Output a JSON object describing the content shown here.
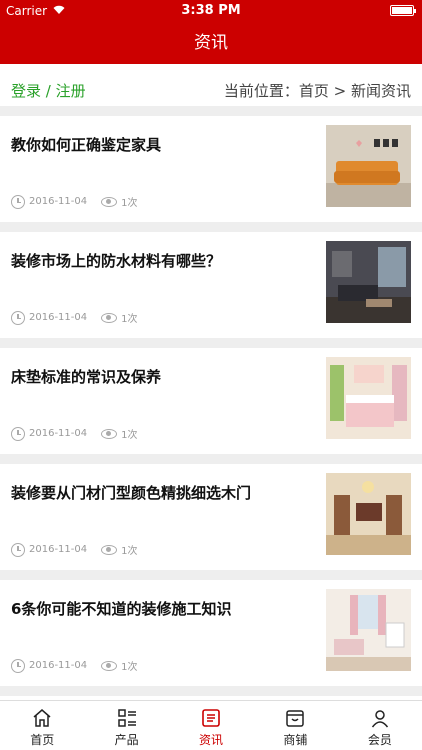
{
  "status": {
    "carrier": "Carrier",
    "time": "3:38 PM"
  },
  "header": {
    "title": "资讯"
  },
  "crumbs": {
    "login": "登录",
    "divider": " / ",
    "register": "注册",
    "location": "当前位置：首页 > 新闻资讯"
  },
  "articles": [
    {
      "title": "教你如何正确鉴定家具",
      "date": "2016-11-04",
      "views": "1次"
    },
    {
      "title": "装修市场上的防水材料有哪些？",
      "date": "2016-11-04",
      "views": "1次"
    },
    {
      "title": "床垫标准的常识及保养",
      "date": "2016-11-04",
      "views": "1次"
    },
    {
      "title": "装修要从门材门型颜色精挑细选木门",
      "date": "2016-11-04",
      "views": "1次"
    },
    {
      "title": "6条你可能不知道的装修施工知识",
      "date": "2016-11-04",
      "views": "1次"
    }
  ],
  "tabs": [
    {
      "label": "首页",
      "icon": "home-icon"
    },
    {
      "label": "产品",
      "icon": "product-list-icon"
    },
    {
      "label": "资讯",
      "icon": "news-icon"
    },
    {
      "label": "商铺",
      "icon": "shop-icon"
    },
    {
      "label": "会员",
      "icon": "member-icon"
    }
  ],
  "colors": {
    "brand": "#cc0000",
    "link": "#2aa12a"
  }
}
